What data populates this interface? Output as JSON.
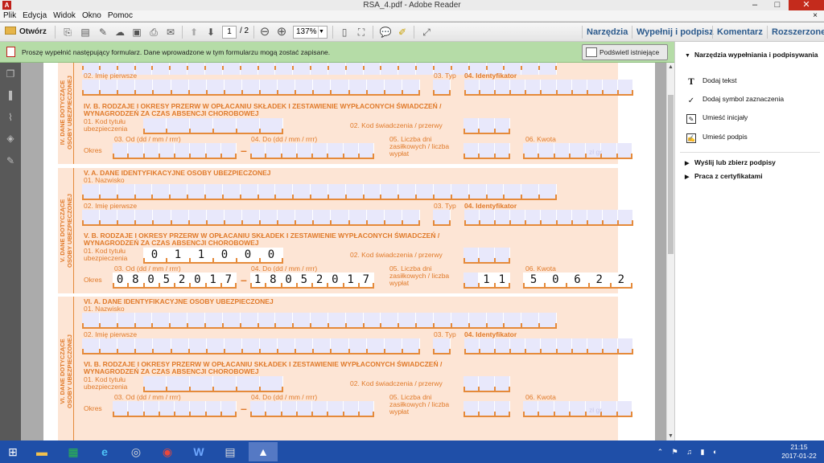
{
  "window": {
    "title": "RSA_4.pdf - Adobe Reader",
    "minimize": "–",
    "maximize": "□",
    "close": "✕"
  },
  "menu": {
    "items": [
      "Plik",
      "Edycja",
      "Widok",
      "Okno",
      "Pomoc"
    ],
    "close": "×"
  },
  "toolbar": {
    "open_label": "Otwórz",
    "page_current": "1",
    "page_total": "/ 2",
    "zoom": "137%",
    "tabs": [
      "Narzędzia",
      "Wypełnij i podpisz",
      "Komentarz",
      "Rozszerzone"
    ]
  },
  "formbar": {
    "message": "Proszę wypełnić następujący formularz. Dane wprowadzone w tym formularzu mogą zostać zapisane.",
    "highlight_label": "Podświetl istniejące pola"
  },
  "right_panel": {
    "section1": "Narzędzia wypełniania i podpisywania",
    "items": [
      {
        "icon": "T",
        "label": "Dodaj tekst"
      },
      {
        "icon": "✓",
        "label": "Dodaj symbol zaznaczenia"
      },
      {
        "icon": "✎",
        "label": "Umieść inicjały"
      },
      {
        "icon": "✍",
        "label": "Umieść podpis"
      }
    ],
    "section2": "Wyślij lub zbierz podpisy",
    "section3": "Praca z certyfikatami"
  },
  "form": {
    "lbl_imie": "02. Imię pierwsze",
    "lbl_typ": "03. Typ",
    "lbl_ident": "04. Identyfikator",
    "lbl_nazwisko": "01. Nazwisko",
    "lbl_kod_tytulu_1": "01. Kod tytułu",
    "lbl_kod_tytulu_2": "ubezpieczenia",
    "lbl_kod_swiad": "02. Kod świadczenia / przerwy",
    "lbl_od": "03. Od (dd / mm / rrrr)",
    "lbl_do": "04. Do (dd / mm / rrrr)",
    "lbl_liczba_1": "05. Liczba dni",
    "lbl_liczba_2": "zasiłkowych / liczba",
    "lbl_liczba_3": "wypłat",
    "lbl_kwota": "06. Kwota",
    "lbl_okres": "Okres",
    "currency": "zł",
    "gr": "gr",
    "sec4_side": "IV. DANE DOTYCZĄCE\nOSOBY UBEZPIECZONEJ",
    "sec4b_title_1": "IV. B. RODZAJE I OKRESY PRZERW  W  OPŁACANIU SKŁADEK I ZESTAWIENIE WYPŁACONYCH ŚWIADCZEŃ /",
    "sec4b_title_2": "WYNAGRODZEŃ ZA CZAS ABSENCJI CHOROBOWEJ",
    "sec5_side": "V. DANE DOTYCZĄCE\nOSOBY UBEZPIECZONEJ",
    "sec5a_title": "V. A. DANE IDENTYFIKACYJNE OSOBY UBEZPIECZONEJ",
    "sec5b_title_1": "V. B. RODZAJE I OKRESY PRZERW  W  OPŁACANIU SKŁADEK I ZESTAWIENIE WYPŁACONYCH ŚWIADCZEŃ /",
    "sec5b_title_2": "WYNAGRODZEŃ ZA CZAS ABSENCJI CHOROBOWEJ",
    "sec5_kod": [
      "0",
      "1",
      "1",
      "0",
      "0",
      "0"
    ],
    "sec5_od": [
      "0",
      "8",
      "0",
      "5",
      "2",
      "0",
      "1",
      "7"
    ],
    "sec5_do": [
      "1",
      "8",
      "0",
      "5",
      "2",
      "0",
      "1",
      "7"
    ],
    "sec5_liczba": [
      "",
      "1",
      "1"
    ],
    "sec5_kwota": [
      "5",
      "0",
      "6",
      "2",
      "2"
    ],
    "sec6_side": "VI. DANE DOTYCZĄCE\nOSOBY UBEZPIECZONEJ",
    "sec6a_title": "VI. A. DANE IDENTYFIKACYJNE OSOBY UBEZPIECZONEJ",
    "sec6b_title_1": "VI. B. RODZAJE I OKRESY PRZERW  W  OPŁACANIU SKŁADEK I ZESTAWIENIE WYPŁACONYCH ŚWIADCZEŃ /",
    "sec6b_title_2": "WYNAGRODZEŃ ZA CZAS ABSENCJI CHOROBOWEJ"
  },
  "taskbar": {
    "clock_time": "21:15",
    "clock_date": "2017-01-22"
  },
  "colors": {
    "form_orange": "#e07a2a",
    "form_bg": "#fde5d5",
    "field_bg": "#e8e8fb",
    "green_bar": "#b5dca7",
    "taskbar": "#1f4fa8"
  }
}
